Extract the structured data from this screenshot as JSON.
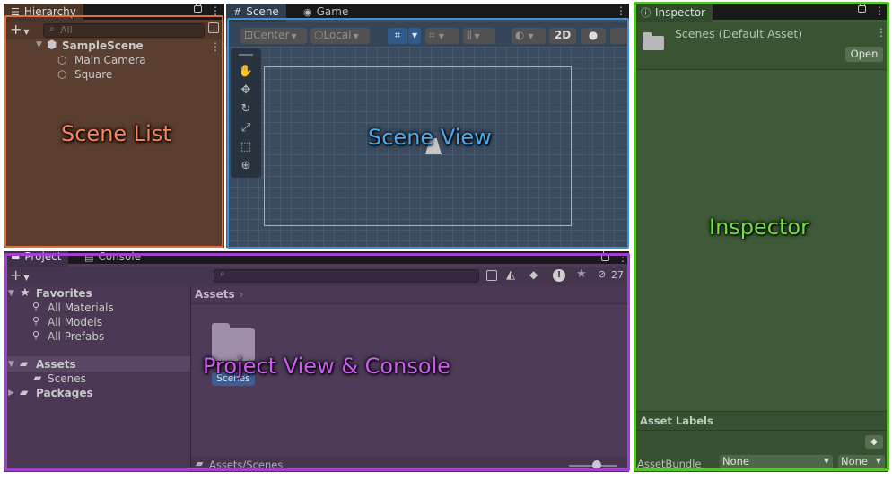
{
  "hierarchy": {
    "tab_label": "Hierarchy",
    "add_label": "+",
    "search_placeholder": "All",
    "scene_name": "SampleScene",
    "items": [
      "Main Camera",
      "Square"
    ]
  },
  "scene_view": {
    "tabs": [
      "Scene",
      "Game"
    ],
    "pivot_label": "Center",
    "space_label": "Local",
    "mode_2d_label": "2D"
  },
  "inspector": {
    "tab_label": "Inspector",
    "asset_title": "Scenes (Default Asset)",
    "open_button": "Open",
    "asset_labels_heading": "Asset Labels",
    "assetbundle_label": "AssetBundle",
    "assetbundle_value": "None",
    "assetbundle_variant": "None"
  },
  "project": {
    "tabs": [
      "Project",
      "Console"
    ],
    "add_label": "+",
    "hidden_count": "27",
    "favorites_label": "Favorites",
    "favorites": [
      "All Materials",
      "All Models",
      "All Prefabs"
    ],
    "assets_label": "Assets",
    "assets_children": [
      "Scenes"
    ],
    "packages_label": "Packages",
    "breadcrumb": "Assets",
    "folder_item_label": "Scenes",
    "footer_path": "Assets/Scenes"
  },
  "annotations": {
    "scene_list": "Scene List",
    "scene_view": "Scene View",
    "inspector": "Inspector",
    "project_console": "Project View & Console"
  },
  "colors": {
    "scene_list_frame": "#e0713c",
    "scene_view_frame": "#3f8fd6",
    "inspector_frame": "#58c22f",
    "project_frame": "#a23fcf",
    "scene_list_text": "#f7835a",
    "scene_view_text": "#4fa8ea",
    "inspector_text": "#6fe03f",
    "project_text": "#cd5cf0"
  }
}
